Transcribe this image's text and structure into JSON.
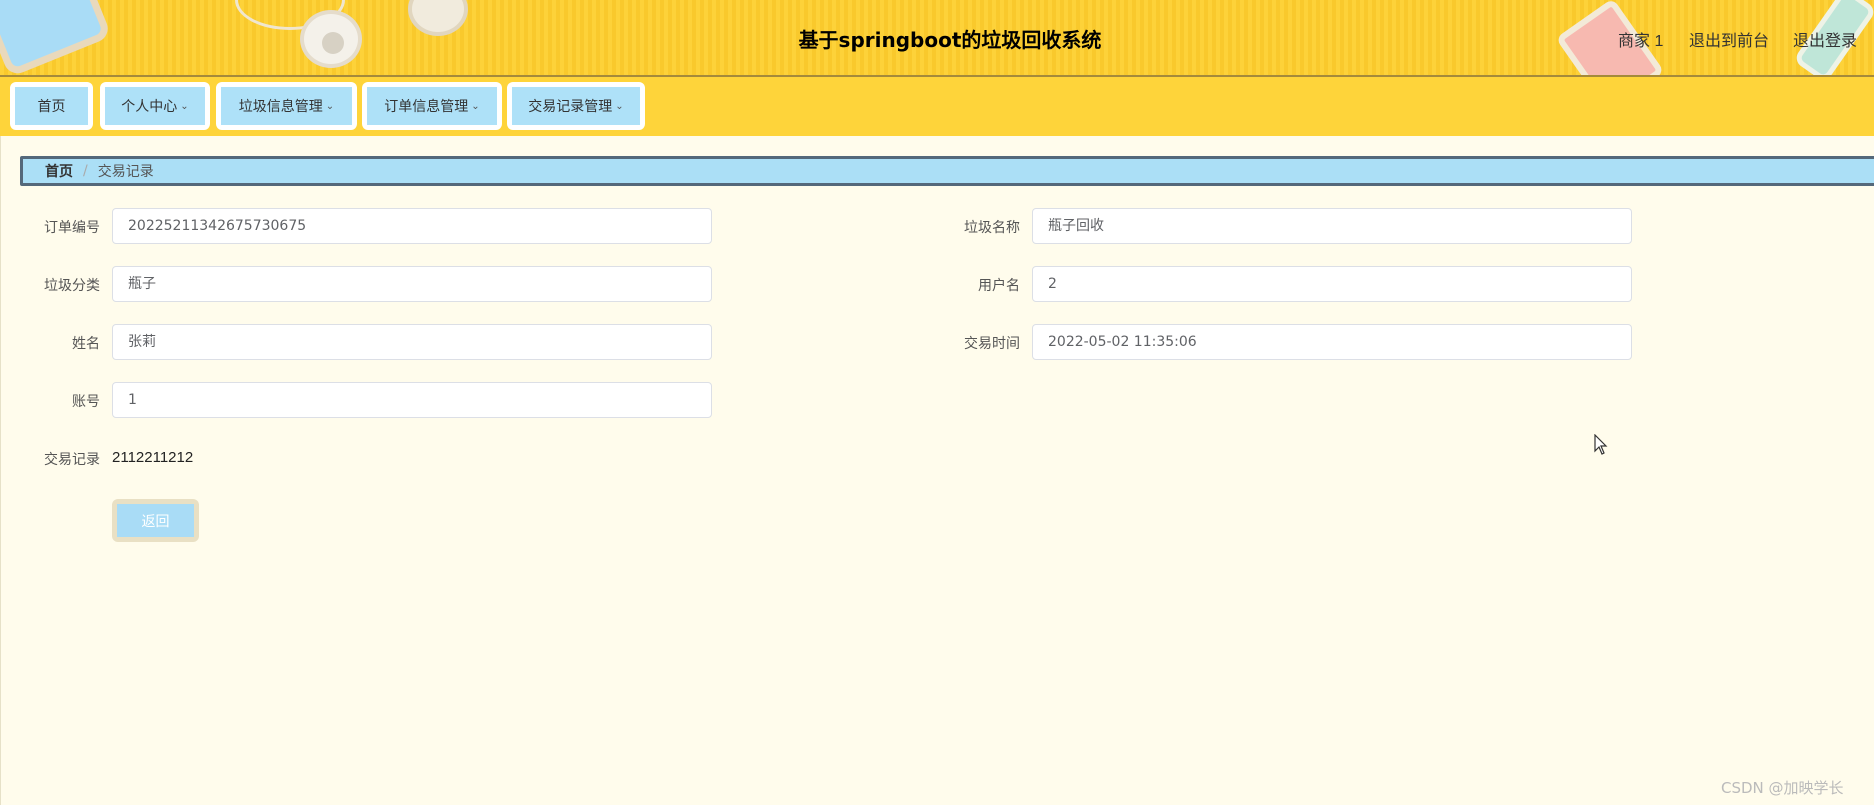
{
  "header": {
    "title": "基于springboot的垃圾回收系统",
    "user": "商家 1",
    "to_front": "退出到前台",
    "logout": "退出登录"
  },
  "nav": {
    "items": [
      {
        "label": "首页",
        "has_dropdown": false
      },
      {
        "label": "个人中心",
        "has_dropdown": true
      },
      {
        "label": "垃圾信息管理",
        "has_dropdown": true
      },
      {
        "label": "订单信息管理",
        "has_dropdown": true
      },
      {
        "label": "交易记录管理",
        "has_dropdown": true
      }
    ],
    "dropdown_glyph": "⌄"
  },
  "breadcrumb": {
    "home": "首页",
    "separator": "/",
    "current": "交易记录"
  },
  "form": {
    "order_no": {
      "label": "订单编号",
      "value": "20225211342675730675"
    },
    "garbage_name": {
      "label": "垃圾名称",
      "value": "瓶子回收"
    },
    "garbage_category": {
      "label": "垃圾分类",
      "value": "瓶子"
    },
    "username": {
      "label": "用户名",
      "value": "2"
    },
    "name": {
      "label": "姓名",
      "value": "张莉"
    },
    "trade_time": {
      "label": "交易时间",
      "value": "2022-05-02 11:35:06"
    },
    "account": {
      "label": "账号",
      "value": "1"
    },
    "trade_record": {
      "label": "交易记录",
      "value": "2112211212"
    }
  },
  "actions": {
    "back_label": "返回"
  },
  "watermark": "CSDN @加映学长",
  "colors": {
    "header_yellow": "#fdd239",
    "nav_blue": "#aee1f8",
    "page_bg": "#fffcec",
    "breadcrumb_border": "#54687a"
  }
}
